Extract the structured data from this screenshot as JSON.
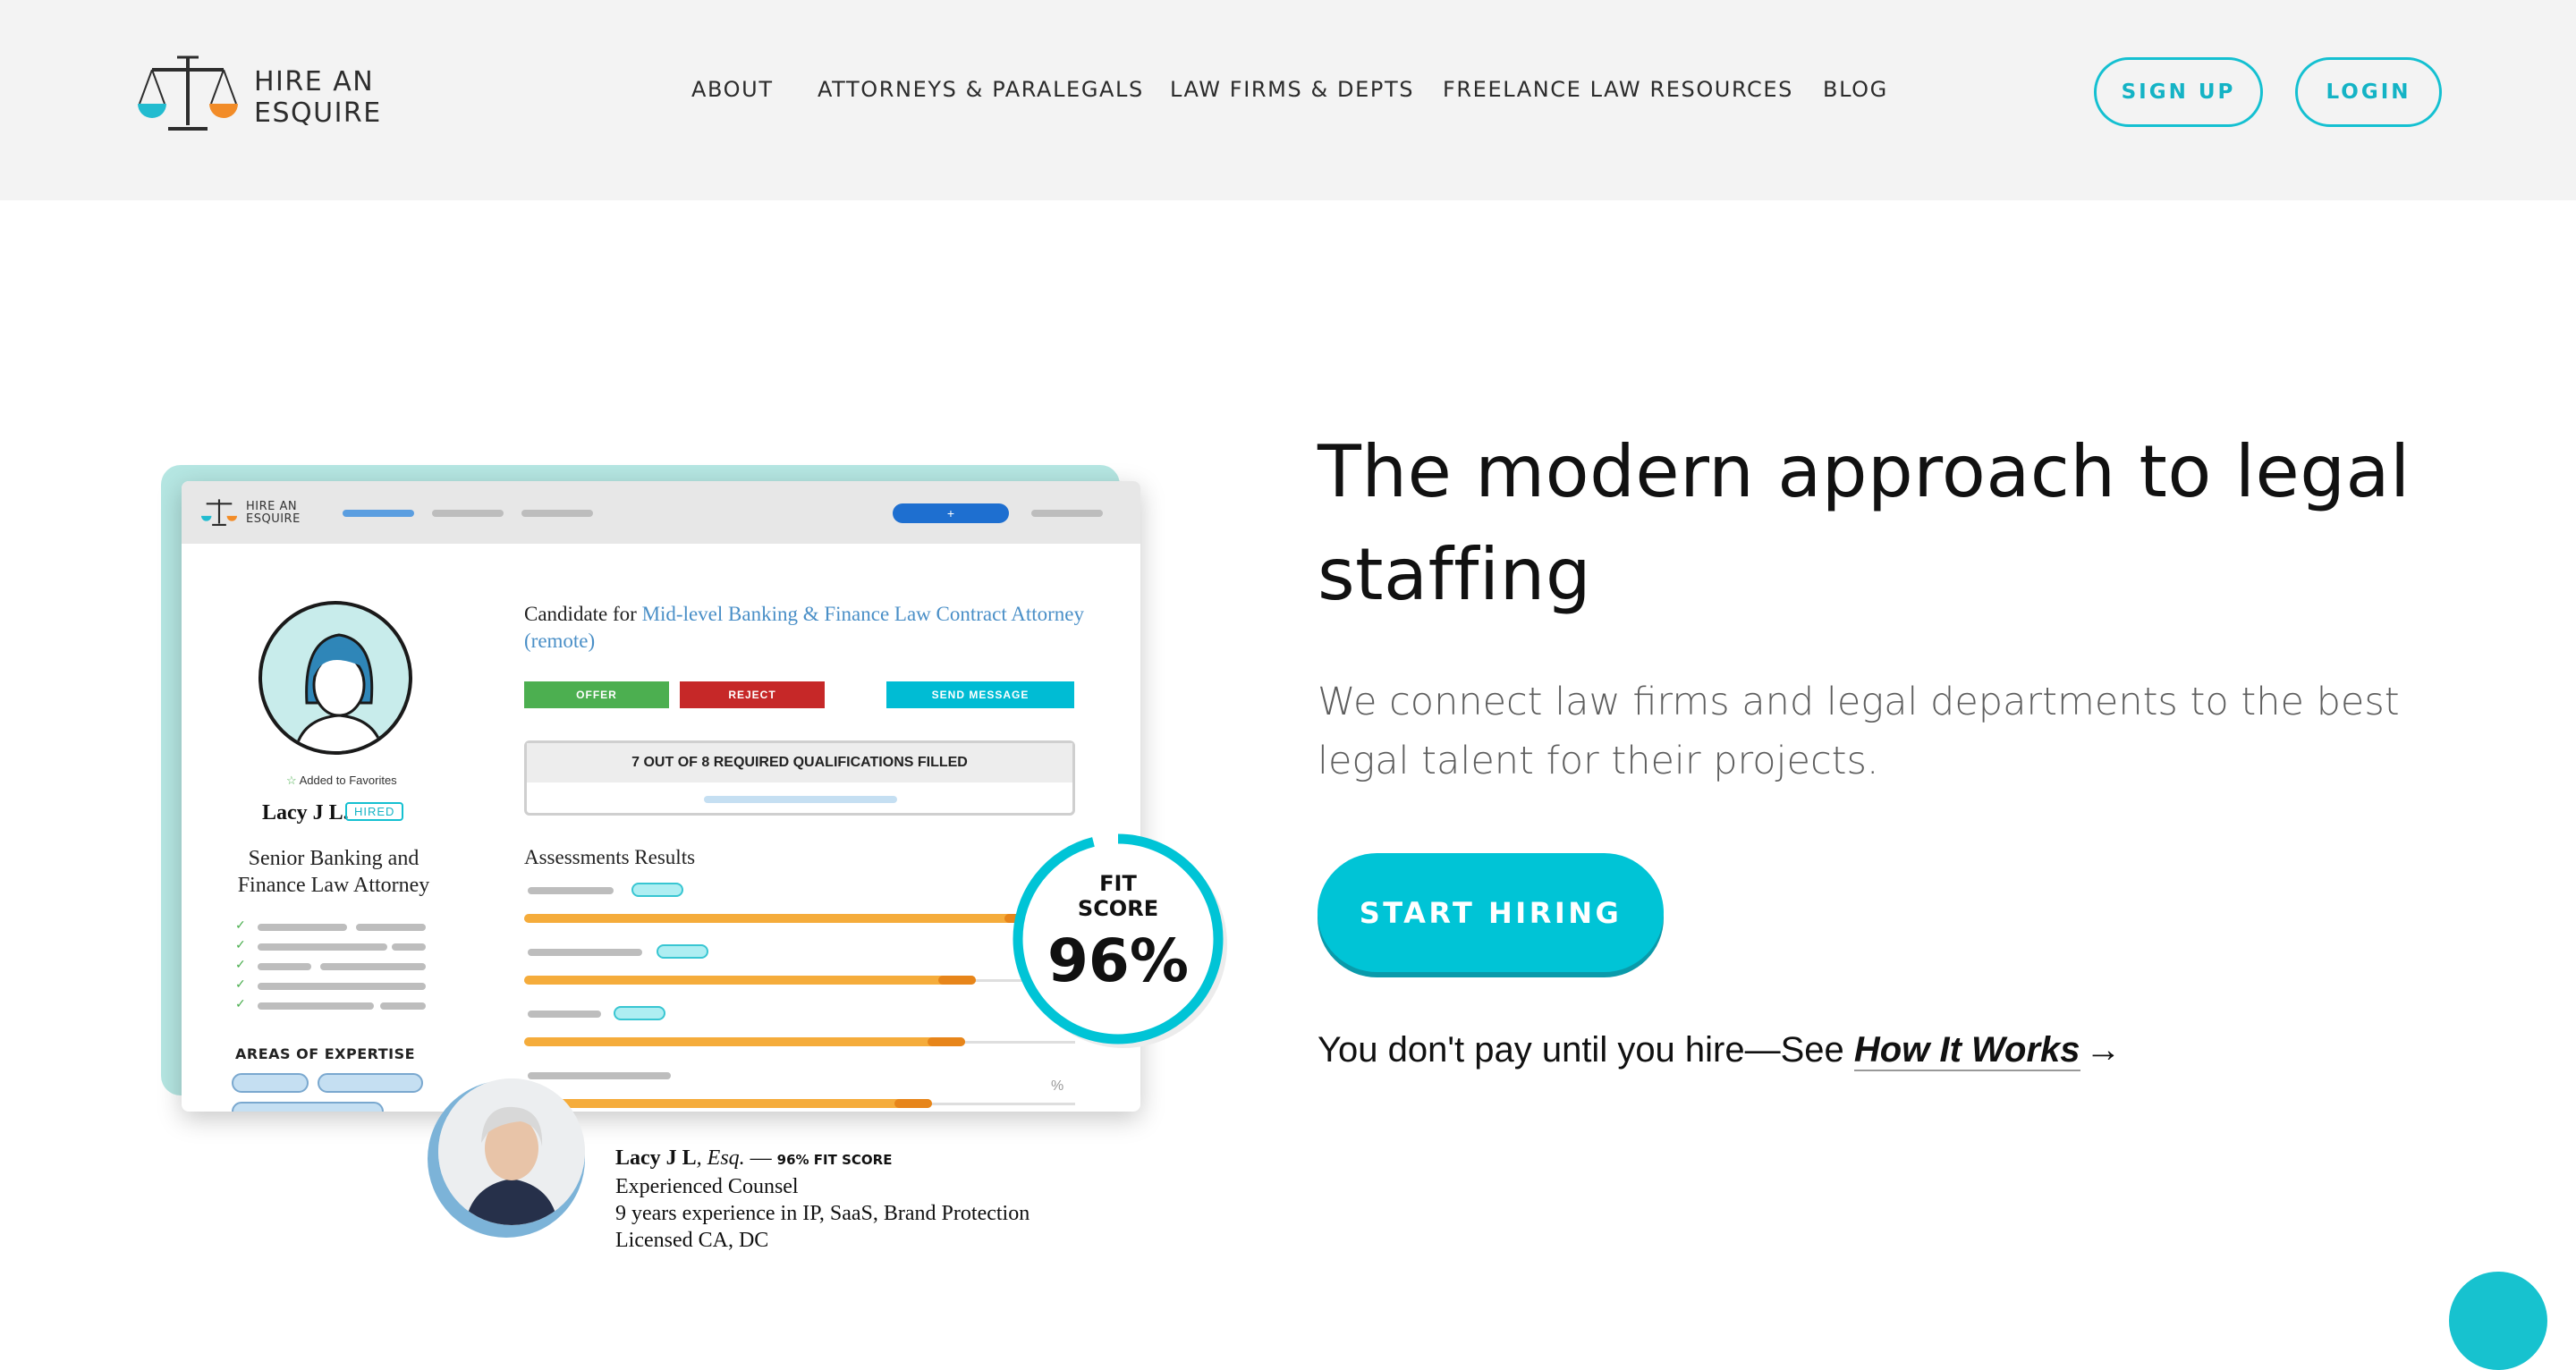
{
  "brand": {
    "line1": "HIRE AN",
    "line2": "ESQUIRE",
    "accent": "#00c4d6"
  },
  "nav": {
    "links": [
      "ABOUT",
      "ATTORNEYS & PARALEGALS",
      "LAW FIRMS & DEPTS",
      "FREELANCE LAW RESOURCES",
      "BLOG"
    ],
    "signup": "SIGN UP",
    "login": "LOGIN"
  },
  "hero": {
    "title": "The modern approach to legal staffing",
    "subtitle": "We connect law firms and legal departments to the best legal talent for their projects.",
    "cta": "START HIRING",
    "pay_prefix": "You don't pay until you hire—See ",
    "pay_link": "How It Works",
    "pay_arrow": "→"
  },
  "mockup": {
    "logo_line1": "HIRE AN",
    "logo_line2": "ESQUIRE",
    "plus": "+",
    "favorites": "Added to Favorites",
    "name": "Lacy J L.",
    "status": "HIRED",
    "title": "Senior Banking and Finance Law Attorney",
    "candidate_prefix": "Candidate for ",
    "candidate_role": "Mid-level Banking & Finance Law Contract Attorney (remote)",
    "offer": "OFFER",
    "reject": "REJECT",
    "send_message": "SEND MESSAGE",
    "qualifications": "7 OUT OF 8 REQUIRED QUALIFICATIONS FILLED",
    "assessments": "Assessments Results",
    "areas": "AREAS OF EXPERTISE",
    "percent_sign": "%",
    "assessment_scores": [
      0.94,
      0.82,
      0.8,
      0.74
    ]
  },
  "fit": {
    "line1": "FIT",
    "line2": "SCORE",
    "value": "96%",
    "fraction": 0.96
  },
  "bio": {
    "name": "Lacy J L",
    "suffix": ", Esq.",
    "dash": " — ",
    "fit": "96% FIT SCORE",
    "role": "Experienced Counsel",
    "experience": "9 years experience in IP, SaaS, Brand Protection",
    "licensed": "Licensed CA, DC"
  }
}
